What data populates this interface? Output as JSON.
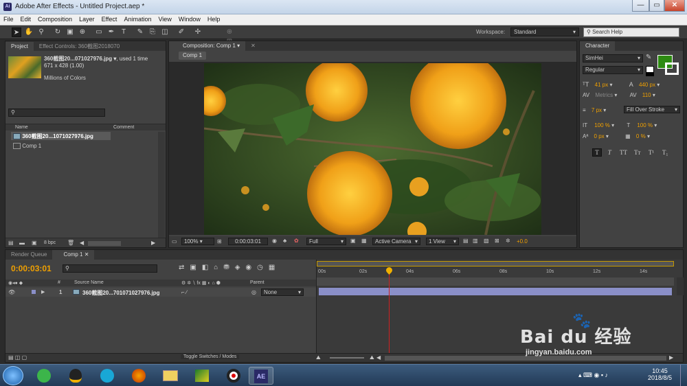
{
  "window": {
    "title": "Adobe After Effects - Untitled Project.aep *",
    "app_icon": "Ai",
    "min": "—",
    "max": "▭",
    "close": "✕"
  },
  "menu": [
    "File",
    "Edit",
    "Composition",
    "Layer",
    "Effect",
    "Animation",
    "View",
    "Window",
    "Help"
  ],
  "toolbar": {
    "workspace_label": "Workspace:",
    "workspace_value": "Standard",
    "search_placeholder": "Search Help"
  },
  "project": {
    "tab_project": "Project",
    "tab_effect_controls": "Effect Controls: 360截图2018070",
    "footage_name": "360截图20...071027976.jpg ▾",
    "used": ", used 1 time",
    "dimensions": "671 x 428 (1.00)",
    "colors": "Millions of Colors",
    "col_name": "Name",
    "col_comment": "Comment",
    "items": [
      "360截图20...1071027976.jpg",
      "Comp 1"
    ],
    "bpc": "8 bpc"
  },
  "composition": {
    "tab": "Composition: Comp 1",
    "sub_tab": "Comp 1",
    "zoom": "100%",
    "timecode": "0:00:03:01",
    "resolution": "Full",
    "camera": "Active Camera",
    "views": "1 View",
    "exposure": "+0.0"
  },
  "character": {
    "tab": "Character",
    "font": "SimHei",
    "style": "Regular",
    "size": "41 px",
    "leading": "440 px",
    "kerning": "Metrics",
    "tracking": "110",
    "stroke_width": "7 px",
    "stroke_mode": "Fill Over Stroke",
    "vscale": "100 %",
    "hscale": "100 %",
    "baseline": "0 px",
    "tsume": "0 %",
    "fill_color": "#2e8b12",
    "style_buttons": [
      "T",
      "T",
      "TT",
      "Tт",
      "T¹",
      "T₁"
    ]
  },
  "timeline": {
    "tab_render": "Render Queue",
    "tab_comp": "Comp 1",
    "timecode": "0:00:03:01",
    "col_source": "Source Name",
    "col_parent": "Parent",
    "layer_num": "1",
    "layer_name": "360截图20...701071027976.jpg",
    "parent_value": "None",
    "ruler": [
      "00s",
      "02s",
      "04s",
      "06s",
      "08s",
      "10s",
      "12s",
      "14s"
    ],
    "toggle": "Toggle Switches / Modes",
    "playhead_seconds": 3.03,
    "duration_seconds": 15
  },
  "taskbar": {
    "time": "10:45",
    "date": "2018/8/5",
    "ae_label": "AE"
  },
  "watermark": {
    "brand": "Bai du 经验",
    "url": "jingyan.baidu.com"
  }
}
